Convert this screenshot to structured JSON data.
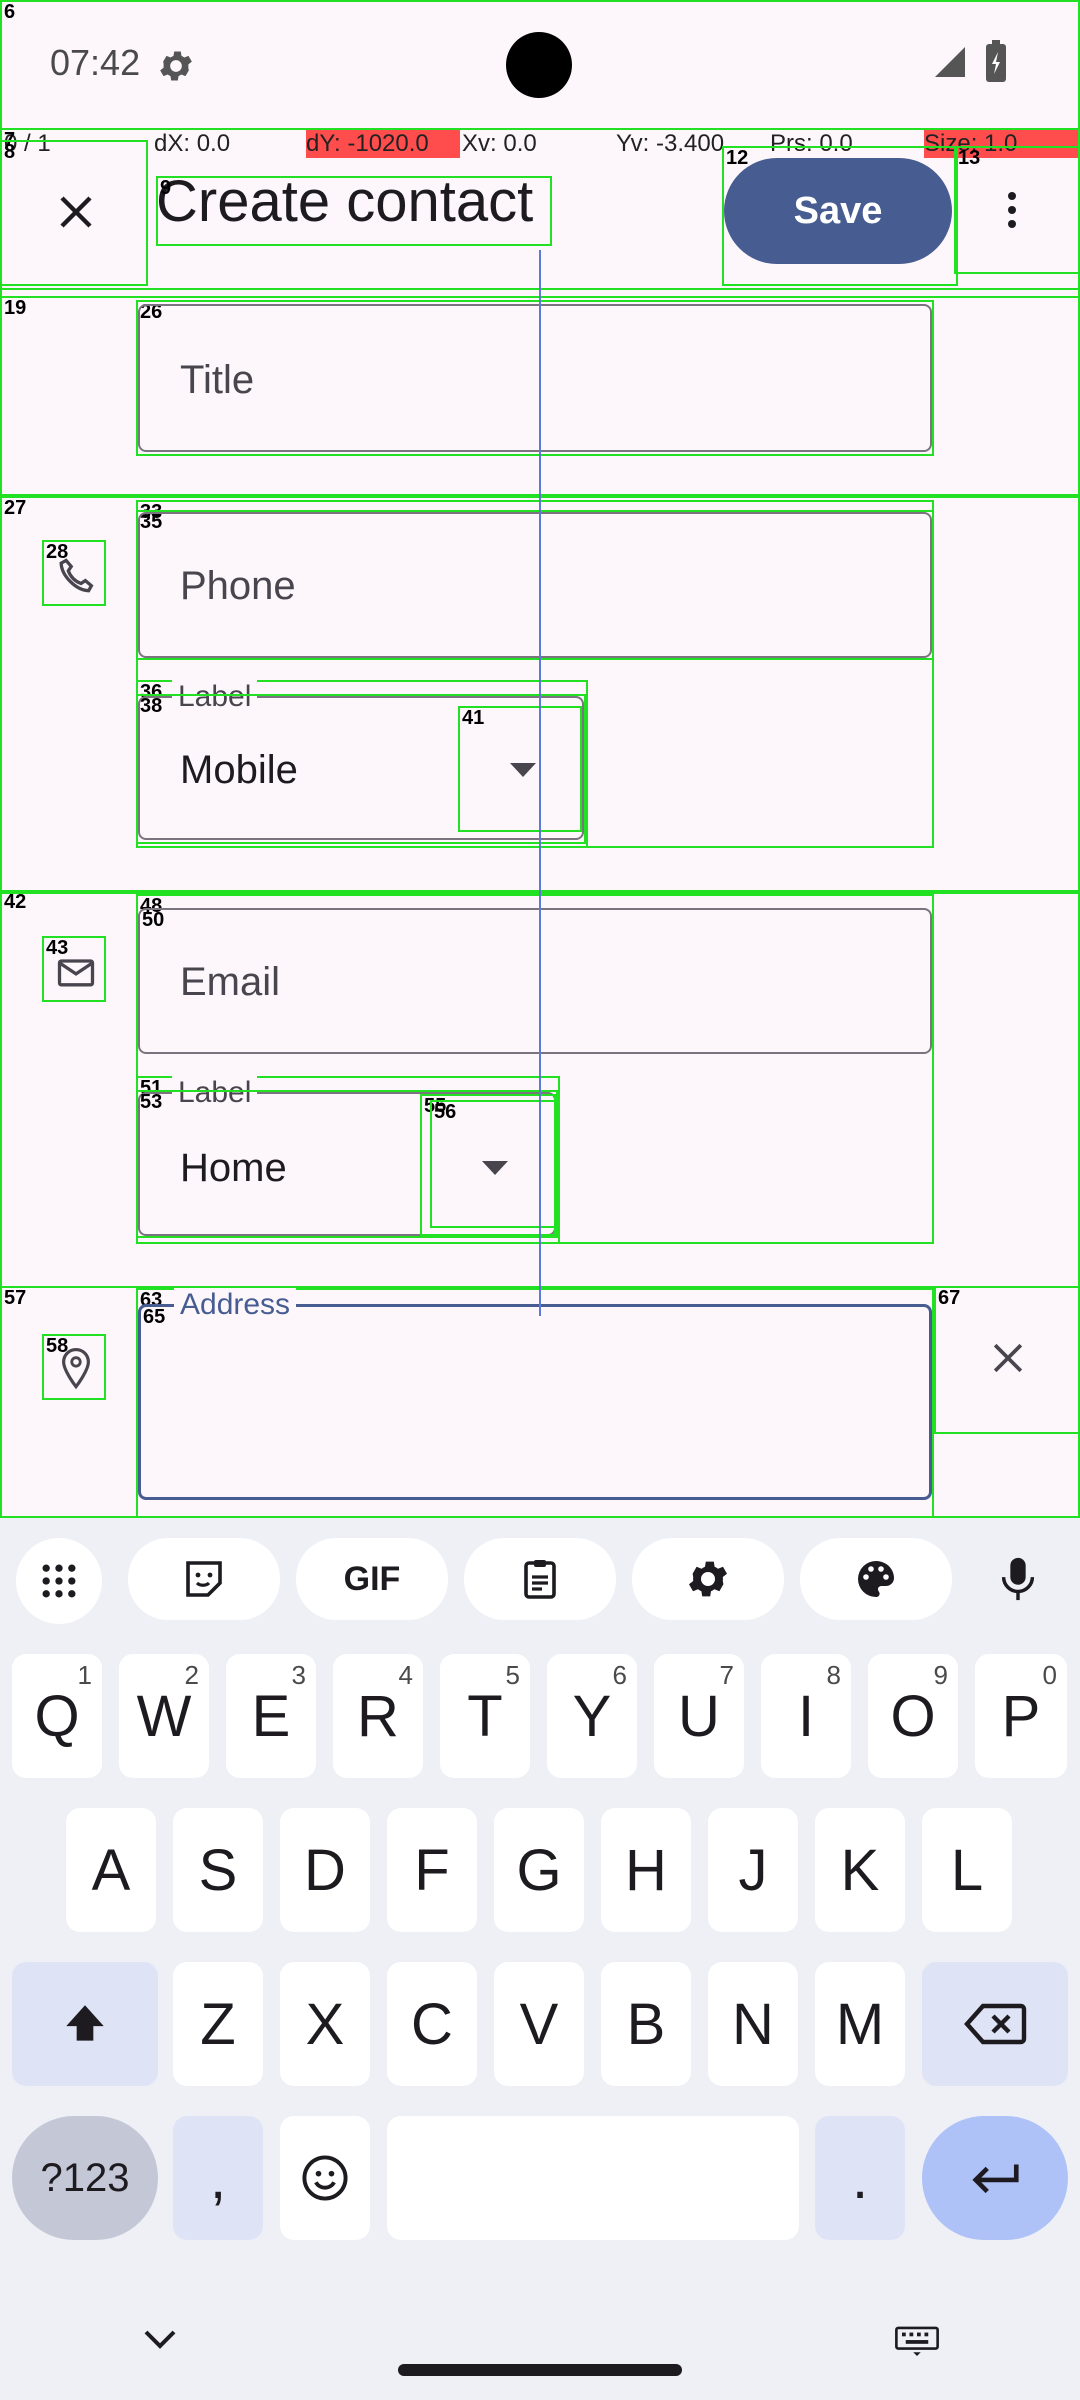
{
  "status_bar": {
    "time": "07:42"
  },
  "debug": {
    "pointer": "0 / 1",
    "dx": "dX: 0.0",
    "dy": "dY: -1020.0",
    "xv": "Xv: 0.0",
    "yv": "Yv: -3.400",
    "prs": "Prs: 0.0",
    "size": "Size: 1.0"
  },
  "app_bar": {
    "title": "Create contact",
    "save_label": "Save"
  },
  "form": {
    "title_placeholder": "Title",
    "phone_placeholder": "Phone",
    "phone_label_caption": "Label",
    "phone_label_value": "Mobile",
    "email_placeholder": "Email",
    "email_label_caption": "Label",
    "email_label_value": "Home",
    "address_label": "Address"
  },
  "overlay_ids": {
    "n6": "6",
    "n7": "7",
    "n8": "8",
    "n9": "9",
    "n12": "12",
    "n13": "13",
    "n19": "19",
    "n26": "26",
    "n27": "27",
    "n28": "28",
    "n33": "33",
    "n35": "35",
    "n36": "36",
    "n38": "38",
    "n41": "41",
    "n42": "42",
    "n43": "43",
    "n48": "48",
    "n50": "50",
    "n51": "51",
    "n53": "53",
    "n55": "55",
    "n56": "56",
    "n57": "57",
    "n58": "58",
    "n63": "63",
    "n65": "65",
    "n67": "67"
  },
  "keyboard": {
    "toolbar": [
      "apps-grid-icon",
      "sticker-icon",
      "gif-label",
      "clipboard-icon",
      "settings-icon",
      "palette-icon",
      "mic-icon"
    ],
    "gif": "GIF",
    "row1": [
      "Q",
      "W",
      "E",
      "R",
      "T",
      "Y",
      "U",
      "I",
      "O",
      "P"
    ],
    "row1_hints": [
      "1",
      "2",
      "3",
      "4",
      "5",
      "6",
      "7",
      "8",
      "9",
      "0"
    ],
    "row2": [
      "A",
      "S",
      "D",
      "F",
      "G",
      "H",
      "J",
      "K",
      "L"
    ],
    "row3": [
      "Z",
      "X",
      "C",
      "V",
      "B",
      "N",
      "M"
    ],
    "sym": "?123",
    "comma": ",",
    "period": "."
  }
}
